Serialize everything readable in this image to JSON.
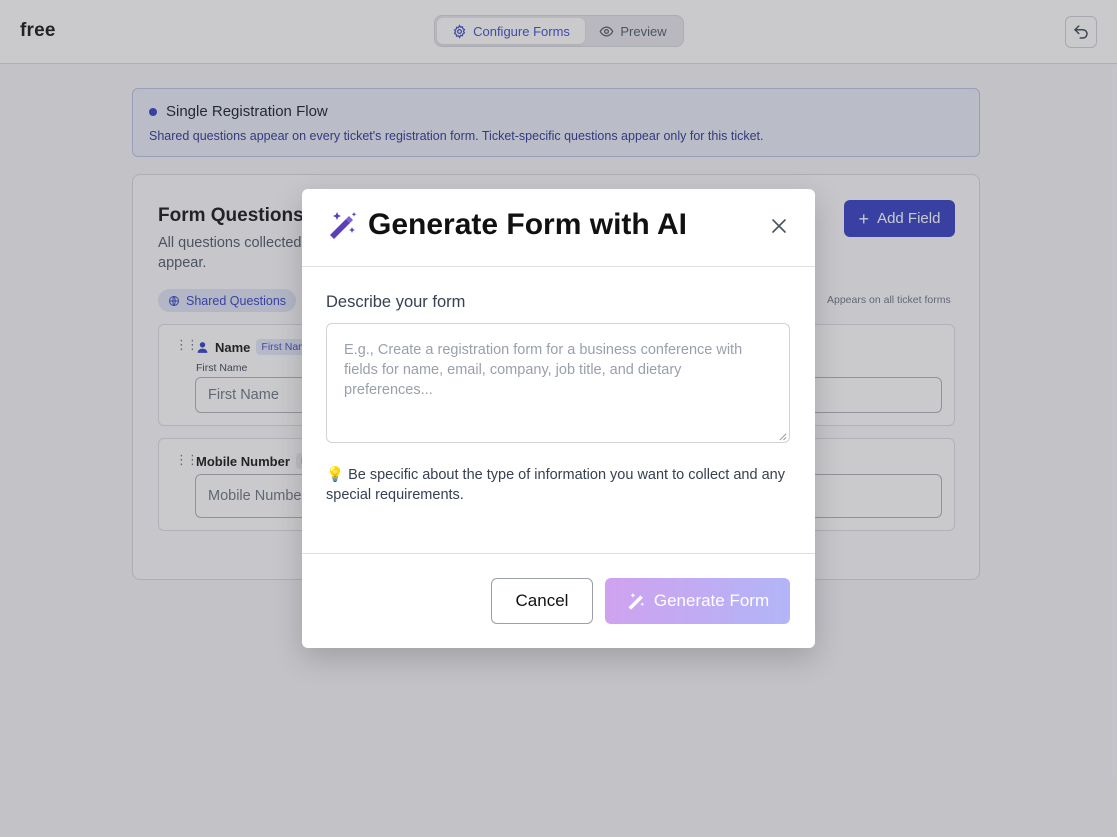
{
  "header": {
    "brand": "free",
    "tabs": [
      {
        "label": "Configure Forms",
        "icon": "gear-icon",
        "active": true
      },
      {
        "label": "Preview",
        "icon": "eye-icon",
        "active": false
      }
    ],
    "undo_icon": "undo-icon"
  },
  "banner": {
    "title": "Single Registration Flow",
    "text": "Shared questions appear on every ticket's registration form. Ticket-specific questions appear only for this ticket."
  },
  "form_card": {
    "title": "Form Questions",
    "description": "All questions collected it will appear.",
    "add_field_label": "Add Field",
    "shared_pill": "Shared Questions",
    "appears_note": "Appears on all ticket forms",
    "fields": [
      {
        "label": "Name",
        "tag": "First Nam",
        "sub_label": "First Name",
        "placeholder": "First Name"
      },
      {
        "label": "Mobile Number",
        "tag": "R",
        "placeholder": "Mobile Numbe"
      }
    ]
  },
  "modal": {
    "title": "Generate Form with AI",
    "title_icon": "magic-wand-icon",
    "describe_label": "Describe your form",
    "prompt_placeholder": "E.g., Create a registration form for a business conference with fields for name, email, company, job title, and dietary preferences...",
    "prompt_value": "",
    "hint": "💡 Be specific about the type of information you want to collect and any special requirements.",
    "cancel_label": "Cancel",
    "generate_label": "Generate Form",
    "colors": {
      "accent": "#2f3cc2",
      "generate_start": "#cfa2ef",
      "generate_end": "#b2b5f7"
    }
  }
}
